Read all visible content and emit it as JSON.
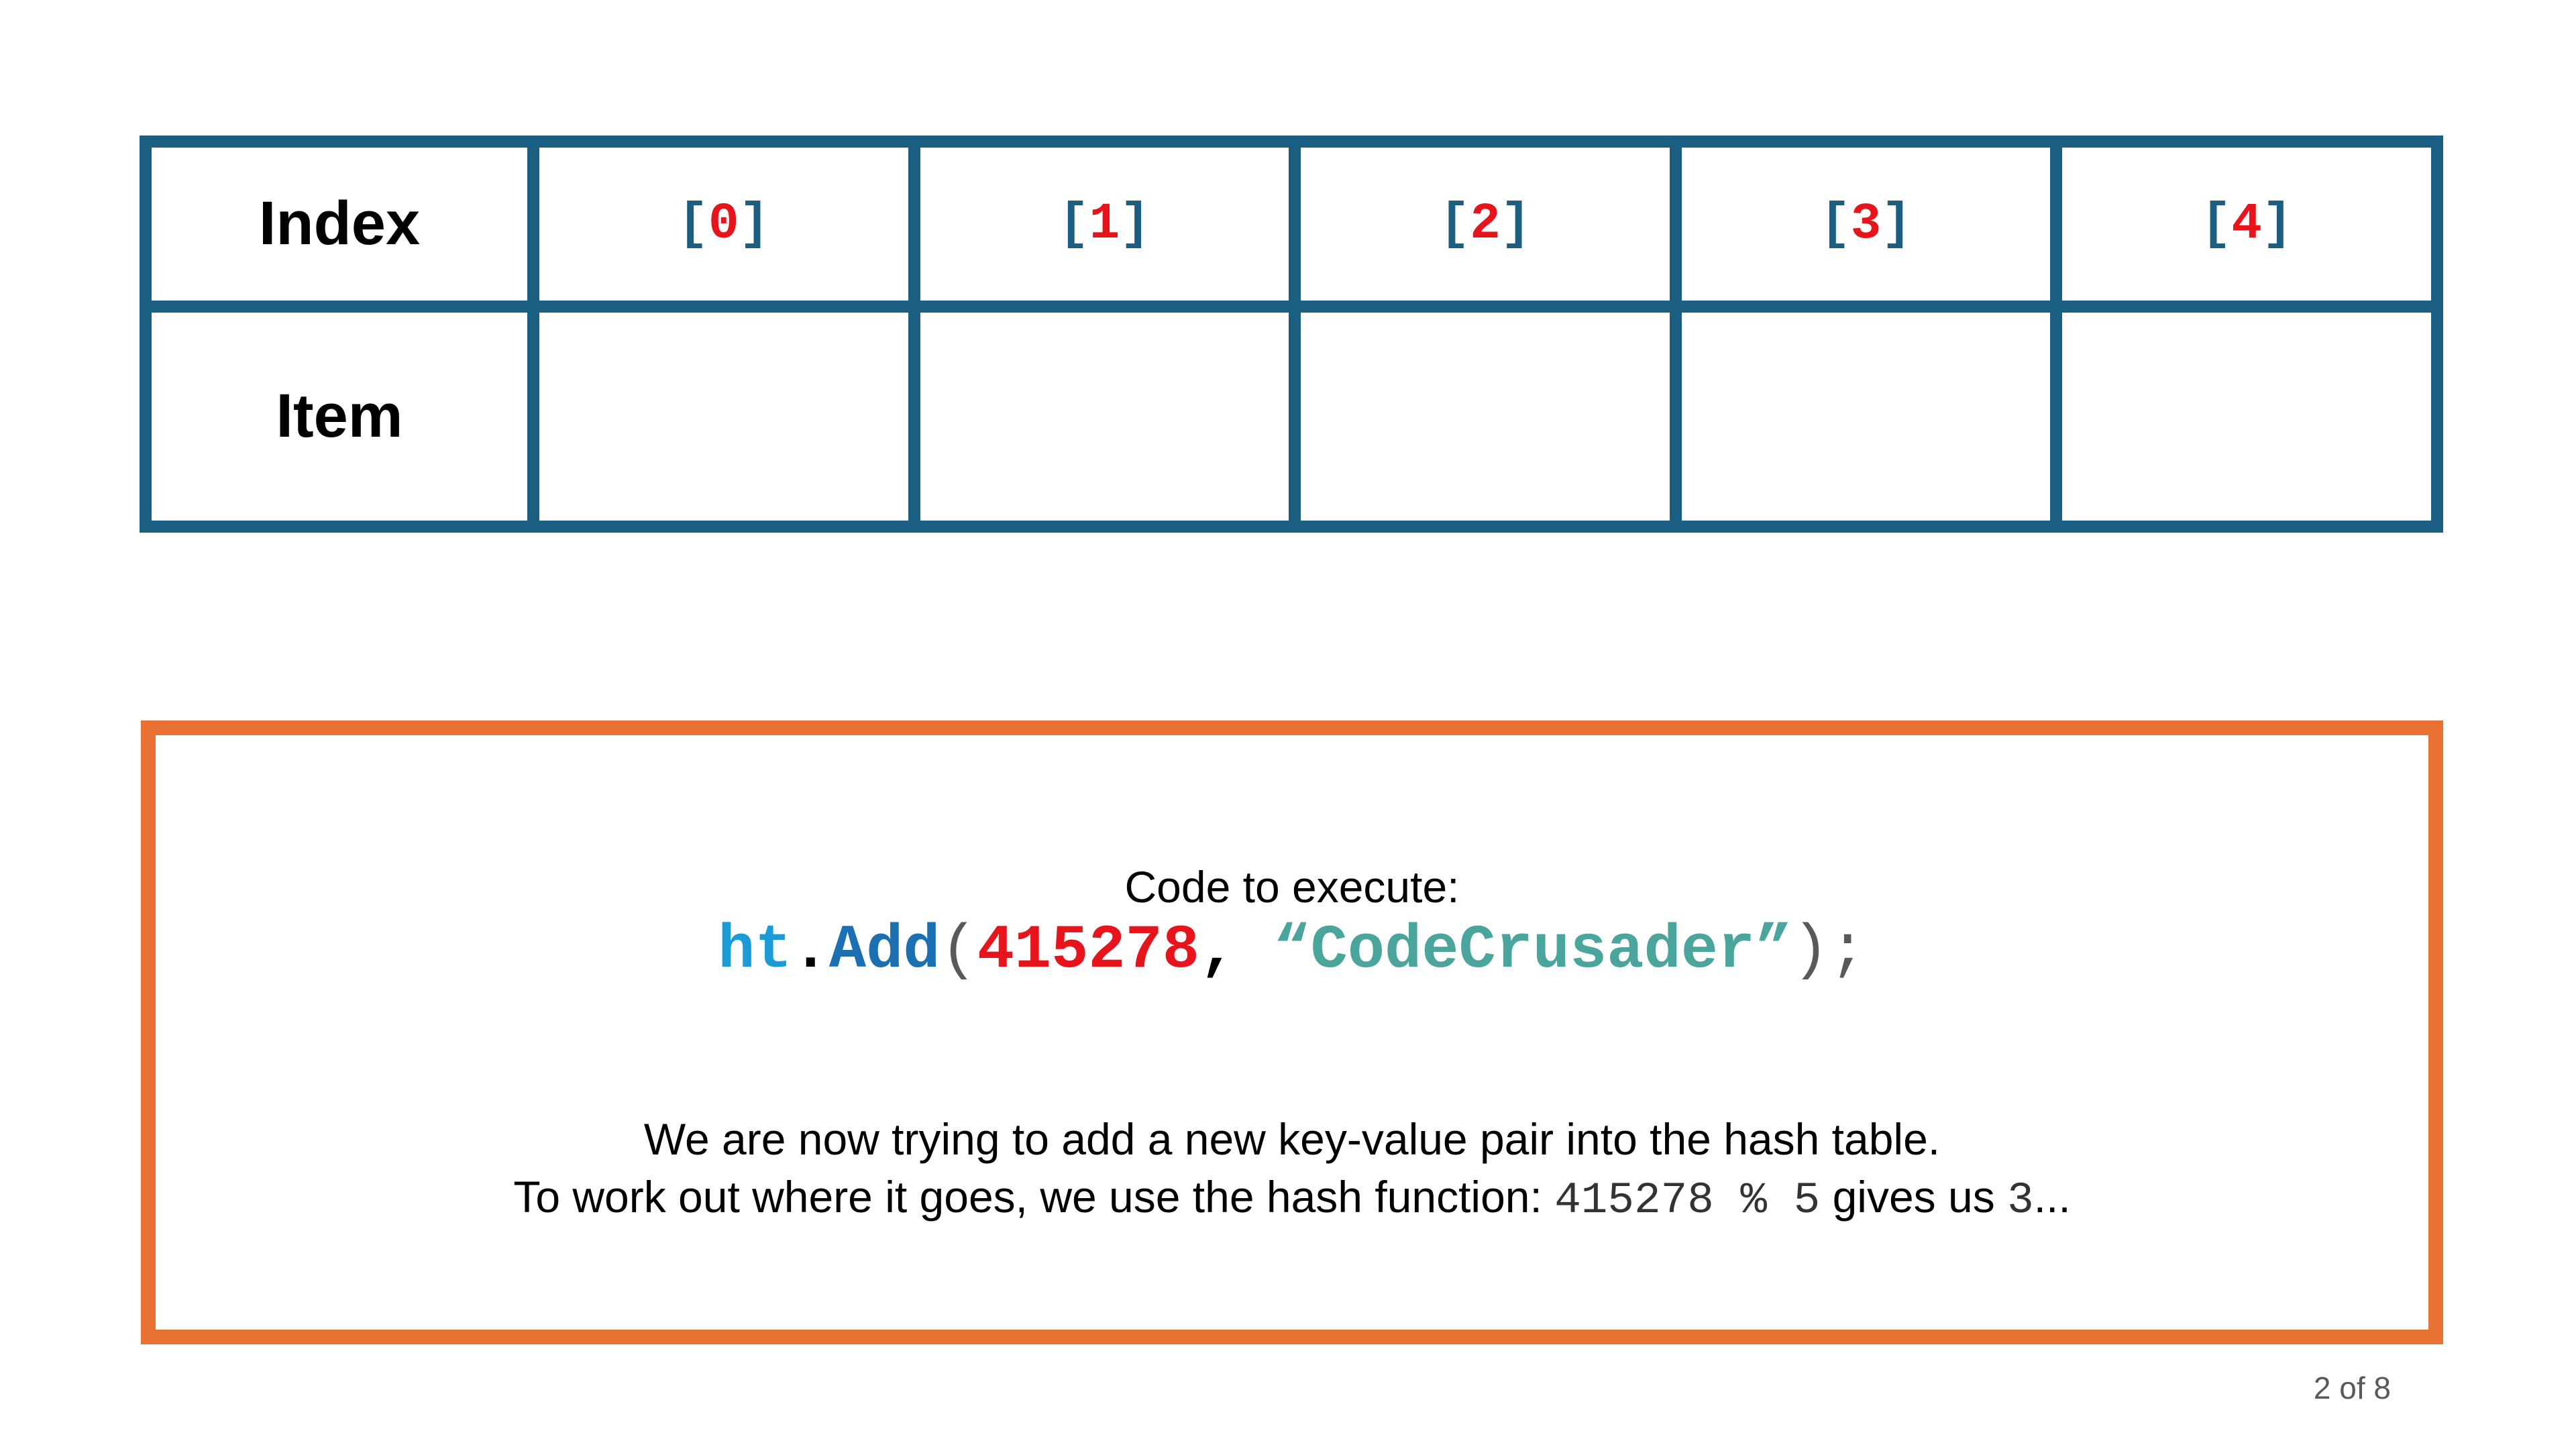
{
  "table": {
    "row_labels": {
      "index": "Index",
      "item": "Item"
    },
    "indices": [
      {
        "open": "[",
        "num": "0",
        "close": "]"
      },
      {
        "open": "[",
        "num": "1",
        "close": "]"
      },
      {
        "open": "[",
        "num": "2",
        "close": "]"
      },
      {
        "open": "[",
        "num": "3",
        "close": "]"
      },
      {
        "open": "[",
        "num": "4",
        "close": "]"
      }
    ],
    "items": [
      "",
      "",
      "",
      "",
      ""
    ]
  },
  "code_box": {
    "heading": "Code to execute:",
    "code": {
      "object": "ht",
      "dot": ".",
      "method": "Add",
      "open_paren": "(",
      "key": "415278",
      "comma": ", ",
      "value": "“CodeCrusader”",
      "close_paren": ")",
      "semicolon": ";"
    },
    "explanation_line1": "We are now trying to add a new key-value pair into the hash table.",
    "explanation_line2": {
      "prefix": "To work out where it goes, we use the hash function: ",
      "expression": "415278 % 5",
      "middle": " gives us ",
      "result": "3",
      "suffix": "..."
    }
  },
  "page_counter": "2 of 8",
  "colors": {
    "table_border": "#1a5f82",
    "box_border": "#e97132",
    "index_number": "#e8141c",
    "string_literal": "#4aa59c"
  }
}
